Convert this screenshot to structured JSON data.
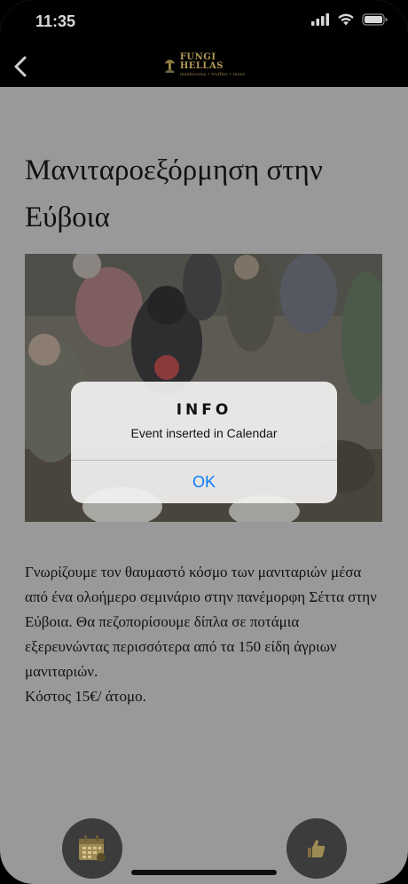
{
  "status_bar": {
    "time": "11:35"
  },
  "nav": {
    "back_icon": "chevron-left-icon",
    "logo_title": "FUNGI HELLAS",
    "logo_subtitle": "mushrooms • truffles • more"
  },
  "event": {
    "title": "Μανιταροεξόρμηση στην Εύβοια",
    "description": "Γνωρίζουμε τον θαυμαστό κόσμο των μανιταριών μέσα από ένα ολοήμερο σεμινάριο στην πανέμορφη Σέττα στην Εύβοια. Θα πεζοπορίσουμε δίπλα σε ποτάμια εξερευνώντας περισσότερα από τα 150 είδη άγριων μανιταριών.",
    "cost": "Κόστος 15€/ άτομο."
  },
  "alert": {
    "title": "INFO",
    "message": "Event inserted in Calendar",
    "ok_label": "OK"
  },
  "bottom_actions": {
    "calendar_icon": "calendar-icon",
    "thumb_icon": "thumbs-up-icon"
  },
  "colors": {
    "overlay_gray": "#999999",
    "alert_button_blue": "#0a7aff",
    "logo_gold": "#b39a55"
  }
}
